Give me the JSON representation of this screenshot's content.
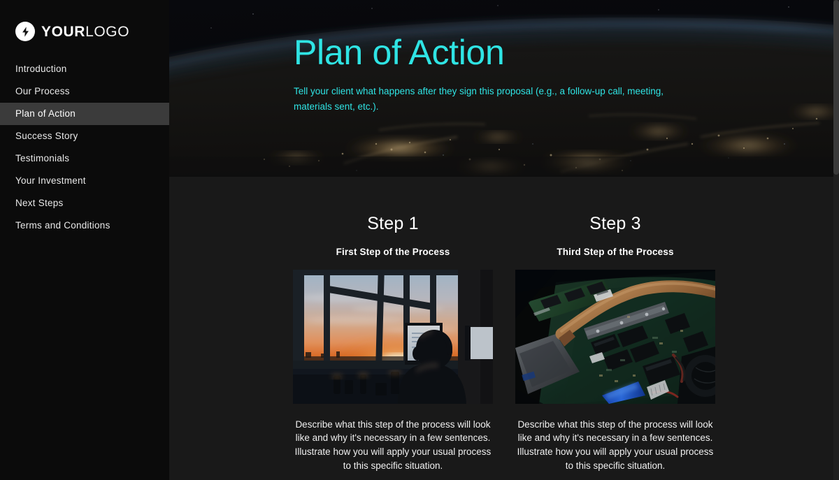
{
  "sidebar": {
    "logo": {
      "icon": "lightning-bolt-icon",
      "text_strong": "YOUR",
      "text_light": "LOGO"
    },
    "items": [
      {
        "label": "Introduction",
        "active": false
      },
      {
        "label": "Our Process",
        "active": false
      },
      {
        "label": "Plan of Action",
        "active": true
      },
      {
        "label": "Success Story",
        "active": false
      },
      {
        "label": "Testimonials",
        "active": false
      },
      {
        "label": "Your Investment",
        "active": false
      },
      {
        "label": "Next Steps",
        "active": false
      },
      {
        "label": "Terms and Conditions",
        "active": false
      }
    ]
  },
  "hero": {
    "title": "Plan of Action",
    "subtitle": "Tell your client what happens after they sign this proposal (e.g., a follow-up call, meeting, materials sent, etc.).",
    "background_image": "earth-from-space-at-night-photo",
    "accent_color": "#2fe4e4"
  },
  "steps": [
    {
      "title": "Step 1",
      "subtitle": "First Step of the Process",
      "image": "person-with-headphones-at-desk-by-window-at-sunset-photo",
      "body": "Describe what this step of the process will look like and why it's necessary in a few sentences. Illustrate how you will apply your usual process to this specific situation."
    },
    {
      "title": "Step 3",
      "subtitle": "Third Step of the Process",
      "image": "laptop-motherboard-circuitry-closeup-photo",
      "body": "Describe what this step of the process will look like and why it's necessary in a few sentences. Illustrate how you will apply your usual process to this specific situation."
    }
  ],
  "colors": {
    "sidebar_background": "#0b0b0b",
    "sidebar_active": "#3b3b3b",
    "content_background": "#191919",
    "accent_cyan": "#2fe4e4",
    "text_primary": "#ffffff"
  }
}
